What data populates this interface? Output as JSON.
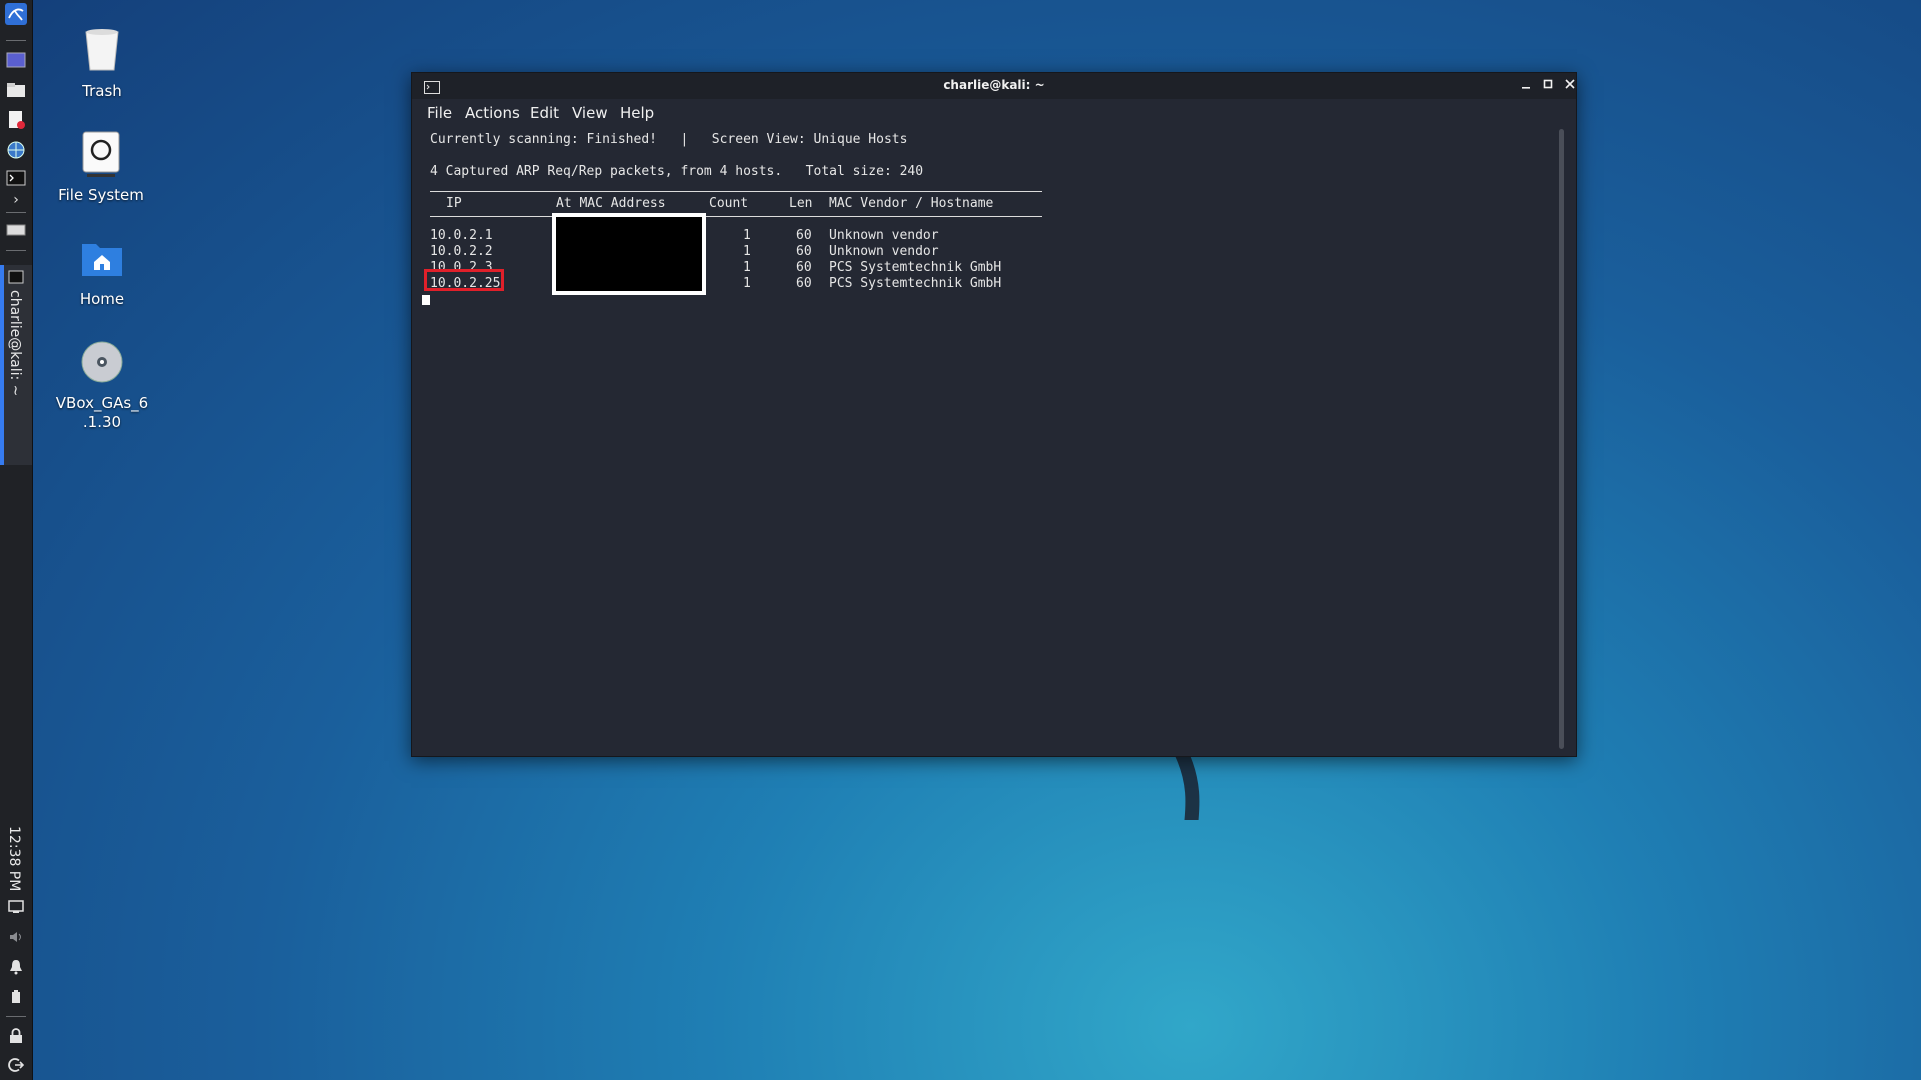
{
  "desktop": {
    "icons": [
      {
        "label": "Trash",
        "icon": "trash-icon"
      },
      {
        "label": "File System",
        "icon": "drive-icon"
      },
      {
        "label": "Home",
        "icon": "home-folder-icon"
      },
      {
        "label": "VBox_GAs_6\n.1.30",
        "icon": "disc-icon"
      }
    ]
  },
  "panel": {
    "task_label": "charlie@kali: ~",
    "clock": "12:38 PM"
  },
  "terminal": {
    "title": "charlie@kali: ~",
    "menu": [
      "File",
      "Actions",
      "Edit",
      "View",
      "Help"
    ],
    "status_line": "Currently scanning: Finished!   |   Screen View: Unique Hosts",
    "summary_line": "4 Captured ARP Req/Rep packets, from 4 hosts.   Total size: 240",
    "table": {
      "headers": {
        "ip": "IP",
        "mac": "At MAC Address",
        "count": "Count",
        "len": "Len",
        "vendor": "MAC Vendor / Hostname"
      },
      "rows": [
        {
          "ip": "10.0.2.1",
          "count": "1",
          "len": "60",
          "vendor": "Unknown vendor"
        },
        {
          "ip": "10.0.2.2",
          "count": "1",
          "len": "60",
          "vendor": "Unknown vendor"
        },
        {
          "ip": "10.0.2.3",
          "count": "1",
          "len": "60",
          "vendor": "PCS Systemtechnik GmbH"
        },
        {
          "ip": "10.0.2.25",
          "count": "1",
          "len": "60",
          "vendor": "PCS Systemtechnik GmbH"
        }
      ]
    },
    "highlighted_ip": "10.0.2.25"
  },
  "colors": {
    "highlight": "#e0202a",
    "panel_accent": "#367bf0",
    "terminal_bg": "#242833"
  }
}
